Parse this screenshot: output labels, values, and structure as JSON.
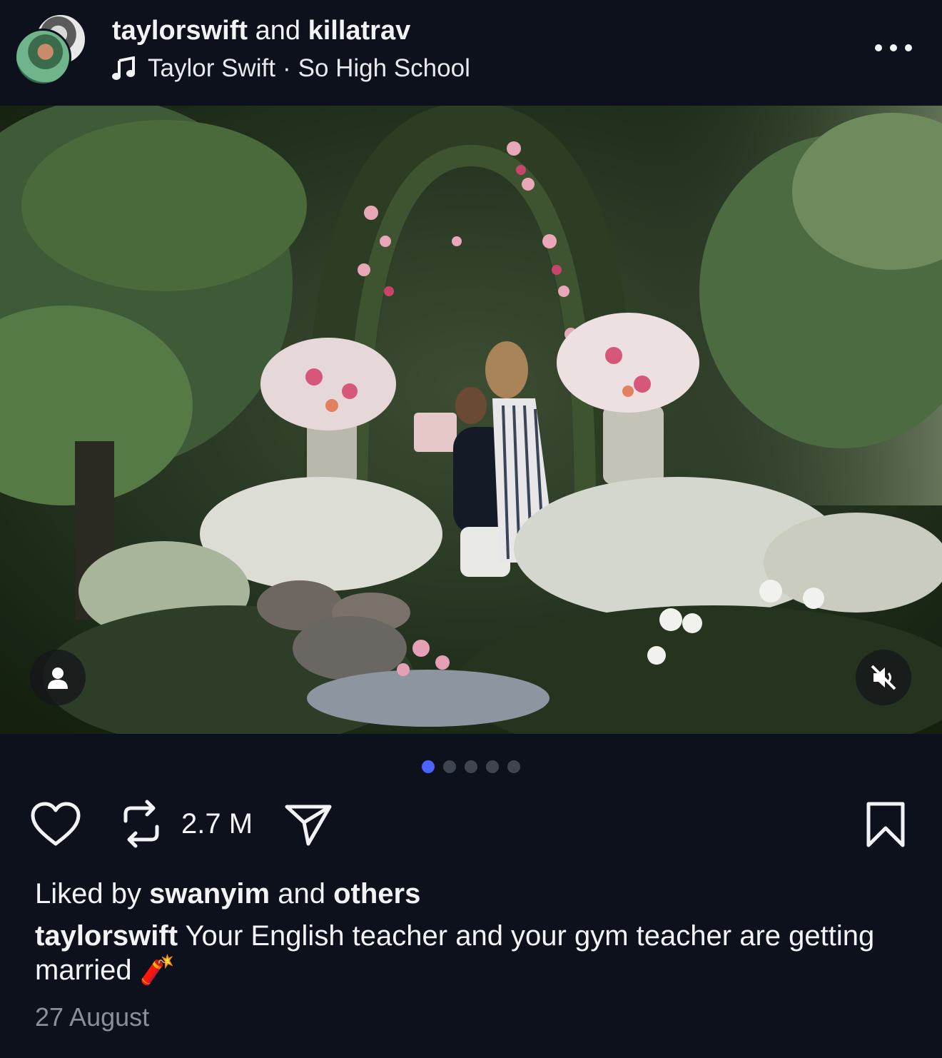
{
  "header": {
    "user1": "taylorswift",
    "joiner": "and",
    "user2": "killatrav",
    "music_artist": "Taylor Swift",
    "music_sep": "·",
    "music_track": "So High School",
    "more_icon": "more-horizontal-icon"
  },
  "media": {
    "description_icon": "photo",
    "person_icon": "person-tag-icon",
    "mute_icon": "speaker-muted-icon",
    "carousel_count": 5,
    "carousel_active": 1
  },
  "actions": {
    "like_icon": "heart-icon",
    "repost_icon": "repost-icon",
    "repost_count": "2.7 M",
    "share_icon": "send-icon",
    "save_icon": "bookmark-icon"
  },
  "likes": {
    "prefix": "Liked by",
    "user": "swanyim",
    "joiner": "and",
    "others": "others"
  },
  "caption": {
    "user": "taylorswift",
    "text": "Your English teacher and your gym teacher are getting married",
    "emoji": "🧨"
  },
  "date": "27 August",
  "colors": {
    "background": "#0c111b",
    "accent": "#4b63ff",
    "muted_text": "#8a8f98"
  }
}
